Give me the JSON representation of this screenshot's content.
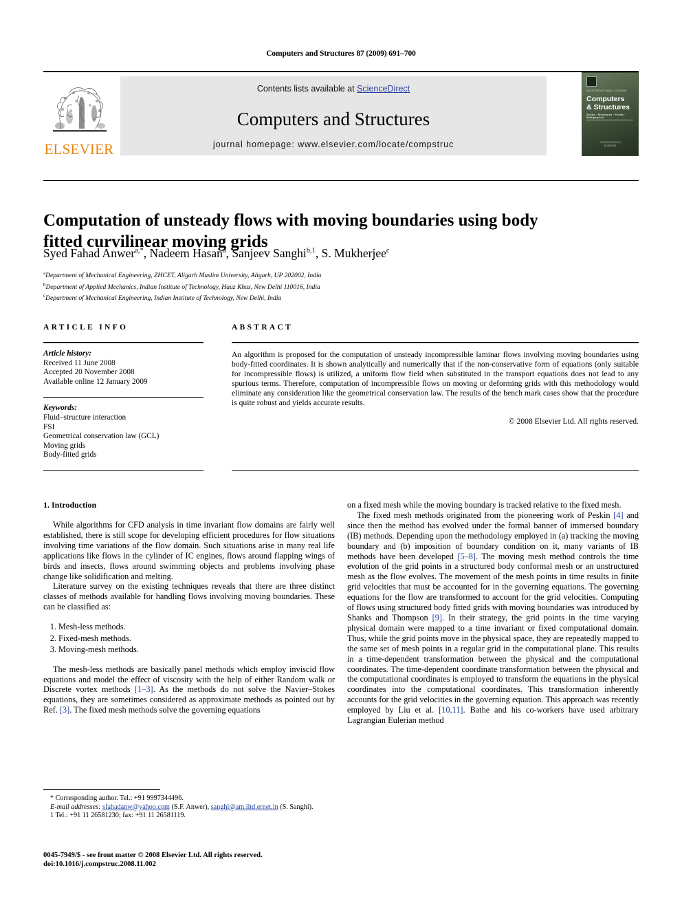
{
  "running_head": "Computers and Structures 87 (2009) 691–700",
  "masthead": {
    "contents_prefix": "Contents lists available at ",
    "sciencedirect": "ScienceDirect",
    "journal_title": "Computers and Structures",
    "homepage": "journal homepage: www.elsevier.com/locate/compstruc",
    "publisher_name": "ELSEVIER",
    "publisher_logo_icon": "elsevier-tree-icon",
    "cover": {
      "tiny_top": "AN INTERNATIONAL JOURNAL",
      "line1": "Computers",
      "line2": "& Structures",
      "subtitle": "Solids · Structures · Fluids · Multiphysics",
      "footer": "ELSEVIER"
    }
  },
  "accent_colors": {
    "elsevier_orange": "#E8820C",
    "link_blue": "#2b3fa0",
    "reference_blue": "#20409a",
    "band_grey": "#e6e6e6"
  },
  "title": "Computation of unsteady flows with moving boundaries using body fitted curvilinear moving grids",
  "authors_html": "Syed Fahad Anwer<sup>a,*</sup>, Nadeem Hasan<sup>a</sup>, Sanjeev Sanghi<sup>b,1</sup>, S. Mukherjee<sup>c</sup>",
  "affiliations": [
    {
      "mark": "a",
      "text": "Department of Mechanical Engineering, ZHCET, Aligarh Muslim University, Aligarh, UP 202002, India"
    },
    {
      "mark": "b",
      "text": "Department of Applied Mechanics, Indian Institute of Technology, Hauz Khas, New Delhi 110016, India"
    },
    {
      "mark": "c",
      "text": "Department of Mechanical Engineering, Indian Institute of Technology, New Delhi, India"
    }
  ],
  "article_info": {
    "label": "ARTICLE INFO",
    "history_heading": "Article history:",
    "history": [
      "Received 11 June 2008",
      "Accepted 20 November 2008",
      "Available online 12 January 2009"
    ],
    "keywords_heading": "Keywords:",
    "keywords": [
      "Fluid–structure interaction",
      "FSI",
      "Geometrical conservation law (GCL)",
      "Moving grids",
      "Body-fitted grids"
    ]
  },
  "abstract": {
    "label": "ABSTRACT",
    "text": "An algorithm is proposed for the computation of unsteady incompressible laminar flows involving moving boundaries using body-fitted coordinates. It is shown analytically and numerically that if the non-conservative form of equations (only suitable for incompressible flows) is utilized, a uniform flow field when substituted in the transport equations does not lead to any spurious terms. Therefore, computation of incompressible flows on moving or deforming grids with this methodology would eliminate any consideration like the geometrical conservation law. The results of the bench mark cases show that the procedure is quite robust and yields accurate results.",
    "copyright": "© 2008 Elsevier Ltd. All rights reserved."
  },
  "body": {
    "section_heading": "1. Introduction",
    "left_p1": "While algorithms for CFD analysis in time invariant flow domains are fairly well established, there is still scope for developing efficient procedures for flow situations involving time variations of the flow domain. Such situations arise in many real life applications like flows in the cylinder of IC engines, flows around flapping wings of birds and insects, flows around swimming objects and problems involving phase change like solidification and melting.",
    "left_p2": "Literature survey on the existing techniques reveals that there are three distinct classes of methods available for handling flows involving moving boundaries. These can be classified as:",
    "methods_list": [
      "Mesh-less methods.",
      "Fixed-mesh methods.",
      "Moving-mesh methods."
    ],
    "left_p3_a": "The mesh-less methods are basically panel methods which employ inviscid flow equations and model the effect of viscosity with the help of either Random walk or Discrete vortex methods ",
    "left_p3_ref1": "[1–3]",
    "left_p3_b": ". As the methods do not solve the Navier–Stokes equations, they are sometimes considered as approximate methods as pointed out by Ref. ",
    "left_p3_ref2": "[3]",
    "left_p3_c": ". The fixed mesh methods solve the governing equations",
    "right_p1": "on a fixed mesh while the moving boundary is tracked relative to the fixed mesh.",
    "right_p2_a": "The fixed mesh methods originated from the pioneering work of Peskin ",
    "right_p2_ref1": "[4]",
    "right_p2_b": " and since then the method has evolved under the formal banner of immersed boundary (IB) methods. Depending upon the methodology employed in (a) tracking the moving boundary and (b) imposition of boundary condition on it, many variants of IB methods have been developed ",
    "right_p2_ref2": "[5–8]",
    "right_p2_c": ". The moving mesh method controls the time evolution of the grid points in a structured body conformal mesh or an unstructured mesh as the flow evolves. The movement of the mesh points in time results in finite grid velocities that must be accounted for in the governing equations. The governing equations for the flow are transformed to account for the grid velocities. Computing of flows using structured body fitted grids with moving boundaries was introduced by Shanks and Thompson ",
    "right_p2_ref3": "[9]",
    "right_p2_d": ". In their strategy, the grid points in the time varying physical domain were mapped to a time invariant or fixed computational domain. Thus, while the grid points move in the physical space, they are repeatedly mapped to the same set of mesh points in a regular grid in the computational plane. This results in a time-dependent transformation between the physical and the computational coordinates. The time-dependent coordinate transformation between the physical and the computational coordinates is employed to transform the equations in the physical coordinates into the computational coordinates. This transformation inherently accounts for the grid velocities in the governing equation. This approach was recently employed by Liu et al. ",
    "right_p2_ref4": "[10,11]",
    "right_p2_e": ". Bathe and his co-workers have used arbitrary Lagrangian Eulerian method"
  },
  "footnotes": {
    "corresponding": "* Corresponding author. Tel.: +91 9997344496.",
    "email_label": "E-mail addresses:",
    "email1": "sfahadanw@yahoo.com",
    "email1_owner": " (S.F. Anwer), ",
    "email2": "sanghi@am.iitd.ernet.in",
    "email2_owner": " (S. Sanghi).",
    "note1": "1 Tel.: +91 11 26581230; fax: +91 11 26581119."
  },
  "imprint": {
    "line1": "0045-7949/$ - see front matter © 2008 Elsevier Ltd. All rights reserved.",
    "line2": "doi:10.1016/j.compstruc.2008.11.002"
  }
}
